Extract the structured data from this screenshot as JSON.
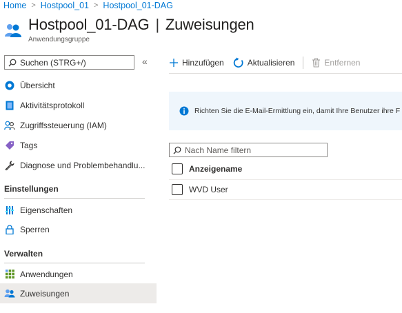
{
  "breadcrumb": [
    "Home",
    "Hostpool_01",
    "Hostpool_01-DAG"
  ],
  "title": {
    "name": "Hostpool_01-DAG",
    "separator": "|",
    "section": "Zuweisungen",
    "subtitle": "Anwendungsgruppe"
  },
  "sidebar": {
    "search_placeholder": "Suchen (STRG+/)",
    "collapse_glyph": "«",
    "items": [
      {
        "label": "Übersicht",
        "icon": "overview-icon"
      },
      {
        "label": "Aktivitätsprotokoll",
        "icon": "activity-log-icon"
      },
      {
        "label": "Zugriffssteuerung (IAM)",
        "icon": "people-icon"
      },
      {
        "label": "Tags",
        "icon": "tag-icon"
      },
      {
        "label": "Diagnose und Problembehandlu...",
        "icon": "wrench-icon"
      }
    ],
    "sections": [
      {
        "title": "Einstellungen",
        "items": [
          {
            "label": "Eigenschaften",
            "icon": "properties-icon"
          },
          {
            "label": "Sperren",
            "icon": "lock-icon"
          }
        ]
      },
      {
        "title": "Verwalten",
        "items": [
          {
            "label": "Anwendungen",
            "icon": "apps-grid-icon"
          },
          {
            "label": "Zuweisungen",
            "icon": "assignments-icon",
            "active": true
          }
        ]
      }
    ]
  },
  "toolbar": {
    "add_label": "Hinzufügen",
    "refresh_label": "Aktualisieren",
    "remove_label": "Entfernen"
  },
  "info_banner": {
    "text": "Richten Sie die E-Mail-Ermittlung ein, damit Ihre Benutzer ihre F"
  },
  "filter": {
    "placeholder": "Nach Name filtern"
  },
  "table": {
    "column_header": "Anzeigename",
    "rows": [
      "WVD User"
    ]
  },
  "colors": {
    "accent": "#0078d4",
    "active_bg": "#edebe9",
    "info_bg": "#eff6fc"
  }
}
